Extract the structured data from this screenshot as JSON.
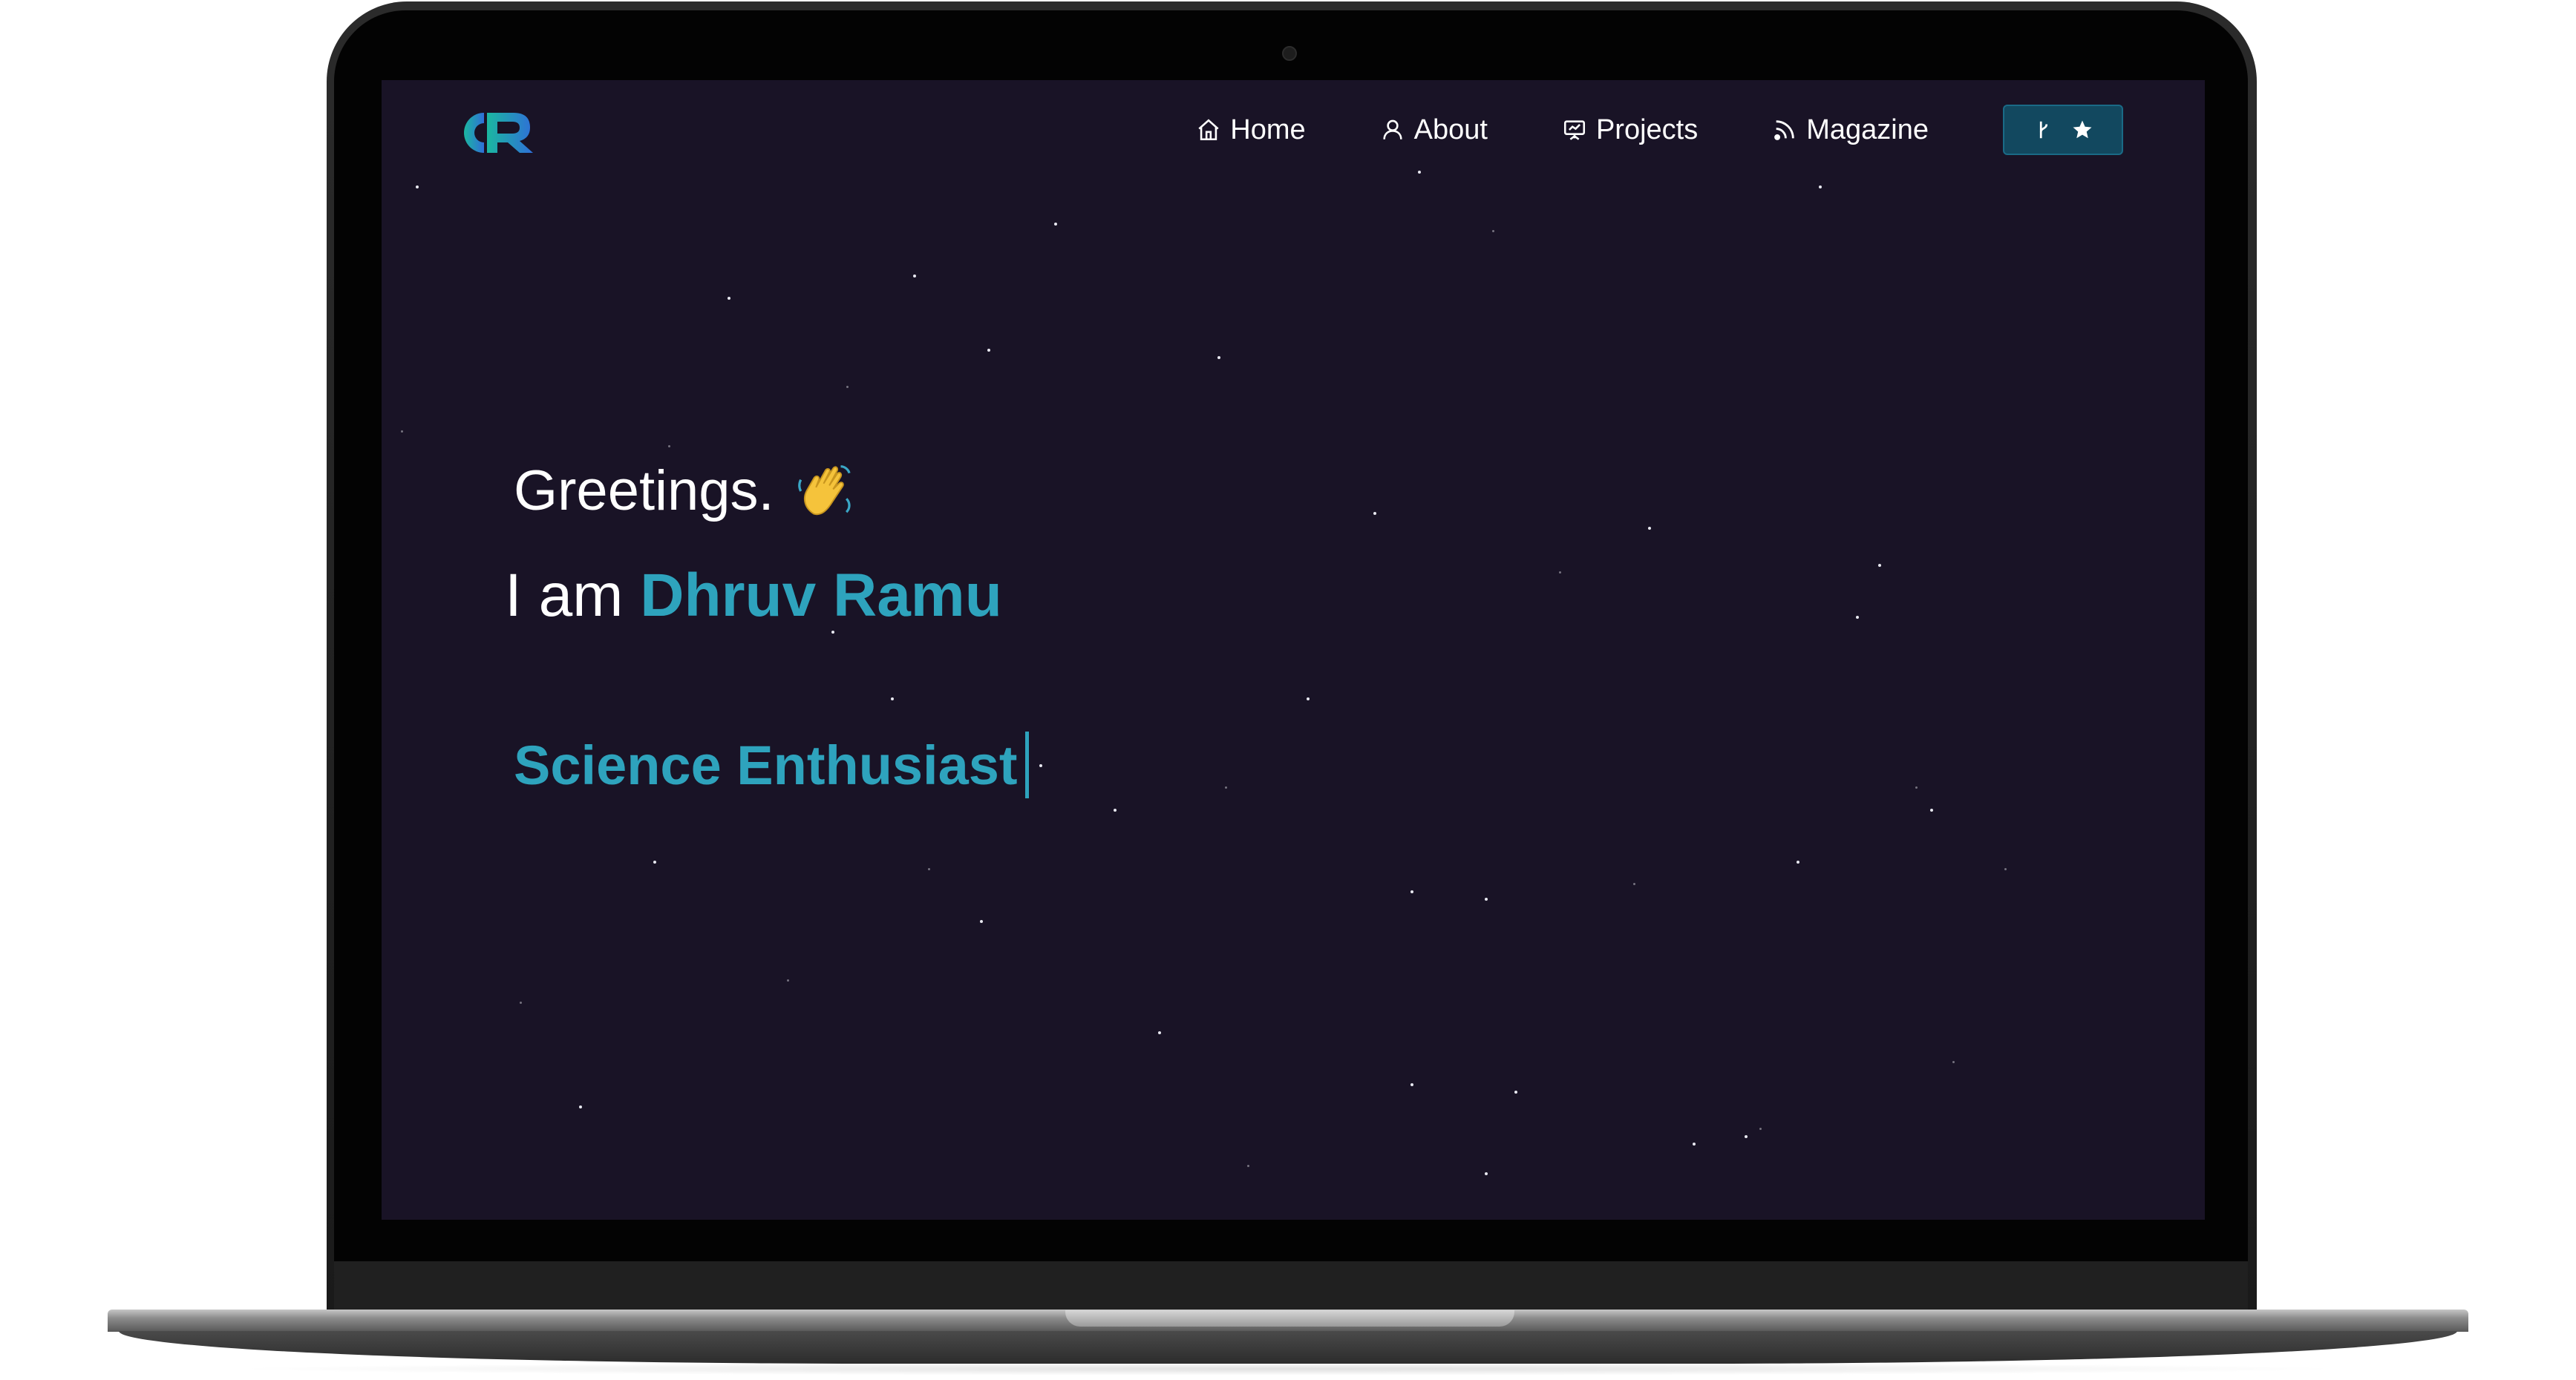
{
  "nav": {
    "items": [
      {
        "label": "Home",
        "icon": "home-icon"
      },
      {
        "label": "About",
        "icon": "user-icon"
      },
      {
        "label": "Projects",
        "icon": "presentation-icon"
      },
      {
        "label": "Magazine",
        "icon": "rss-icon"
      }
    ],
    "github_button": {
      "icons": [
        "git-fork-icon",
        "star-icon"
      ]
    }
  },
  "logo": {
    "text": "DR",
    "colors": [
      "#1bb7a0",
      "#2f6fd8"
    ]
  },
  "hero": {
    "greeting": "Greetings.",
    "intro_prefix": "I am",
    "name": "Dhruv Ramu",
    "typed_text": "Science Enthusiast"
  },
  "colors": {
    "background": "#191326",
    "accent": "#2ea3bd",
    "button_bg": "#12485f"
  }
}
